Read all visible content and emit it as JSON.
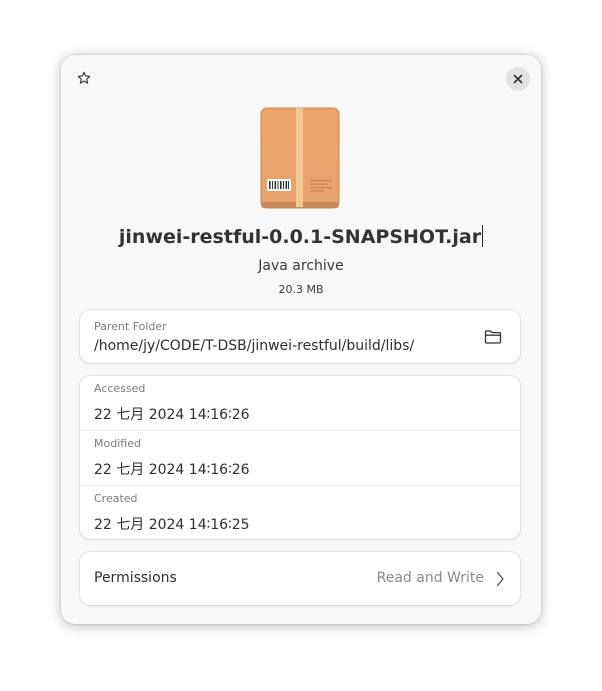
{
  "file": {
    "name": "jinwei-restful-0.0.1-SNAPSHOT.jar",
    "type": "Java archive",
    "size": "20.3 MB"
  },
  "parent_folder": {
    "label": "Parent Folder",
    "path": "/home/jy/CODE/T-DSB/jinwei-restful/build/libs/"
  },
  "dates": {
    "accessed": {
      "label": "Accessed",
      "value": "22 七月 2024 14∶16∶26"
    },
    "modified": {
      "label": "Modified",
      "value": "22 七月 2024 14∶16∶26"
    },
    "created": {
      "label": "Created",
      "value": "22 七月 2024 14∶16∶25"
    }
  },
  "permissions": {
    "label": "Permissions",
    "value": "Read and Write"
  },
  "icons": {
    "star": "star-icon",
    "close": "close-icon",
    "file": "archive-file-icon",
    "folder": "folder-open-icon",
    "chevron": "chevron-right-icon"
  },
  "colors": {
    "archive_body": "#e8a56c",
    "archive_stripe": "#f3c89a",
    "dialog_bg": "#f8f8f8",
    "card_bg": "#ffffff"
  }
}
